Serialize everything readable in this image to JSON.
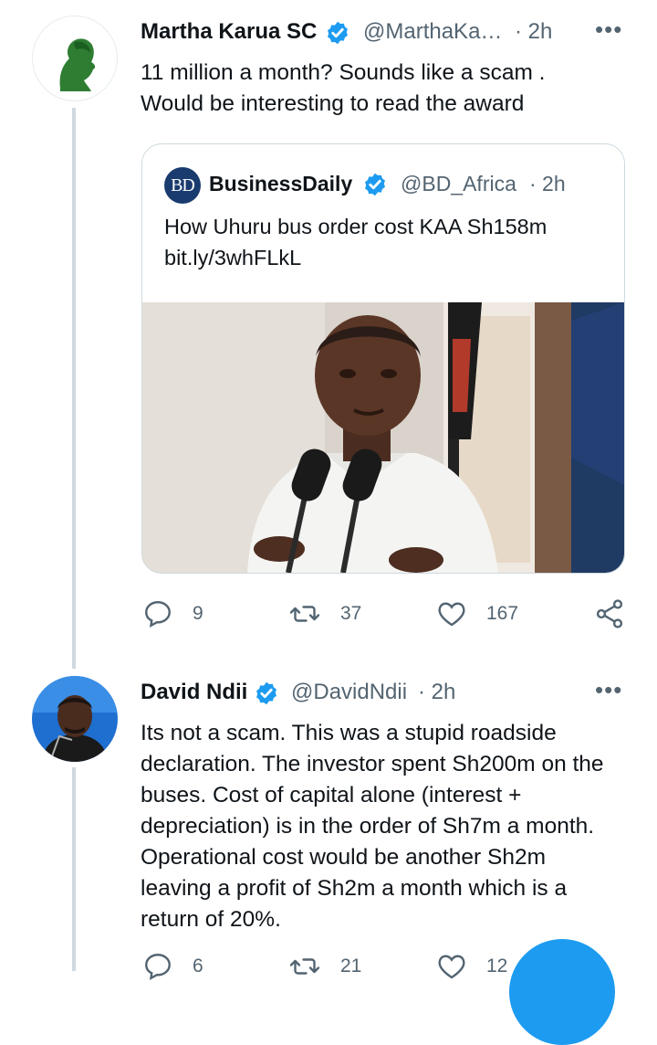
{
  "tweet1": {
    "name": "Martha Karua SC",
    "handle": "@MarthaKa…",
    "time": "· 2h",
    "text_line1": "11 million a month? Sounds like a scam .",
    "text_line2": "Would be interesting to read the award",
    "quote": {
      "logo_text": "BD",
      "name": "BusinessDaily",
      "handle": "@BD_Africa",
      "time": "· 2h",
      "text_line1": "How Uhuru bus order cost KAA Sh158m",
      "text_line2": "bit.ly/3whFLkL"
    },
    "stats": {
      "replies": "9",
      "retweets": "37",
      "likes": "167"
    }
  },
  "tweet2": {
    "name": "David Ndii",
    "handle": "@DavidNdii",
    "time": "· 2h",
    "lines": [
      "Its not a scam. This was a stupid roadside",
      "declaration. The investor spent Sh200m on the",
      "buses. Cost of capital alone (interest +",
      "depreciation) is in the order of Sh7m a month.",
      "Operational cost would be another Sh2m",
      "leaving a profit of Sh2m a month which is a",
      "return of 20%."
    ],
    "stats": {
      "replies": "6",
      "retweets": "21",
      "likes": "12"
    }
  },
  "colors": {
    "verified": "#1d9bf0",
    "secondary_text": "#536471",
    "border": "#cfd9de"
  },
  "icons": [
    "verified-badge-icon",
    "more-icon",
    "reply-icon",
    "retweet-icon",
    "like-icon",
    "share-icon"
  ]
}
